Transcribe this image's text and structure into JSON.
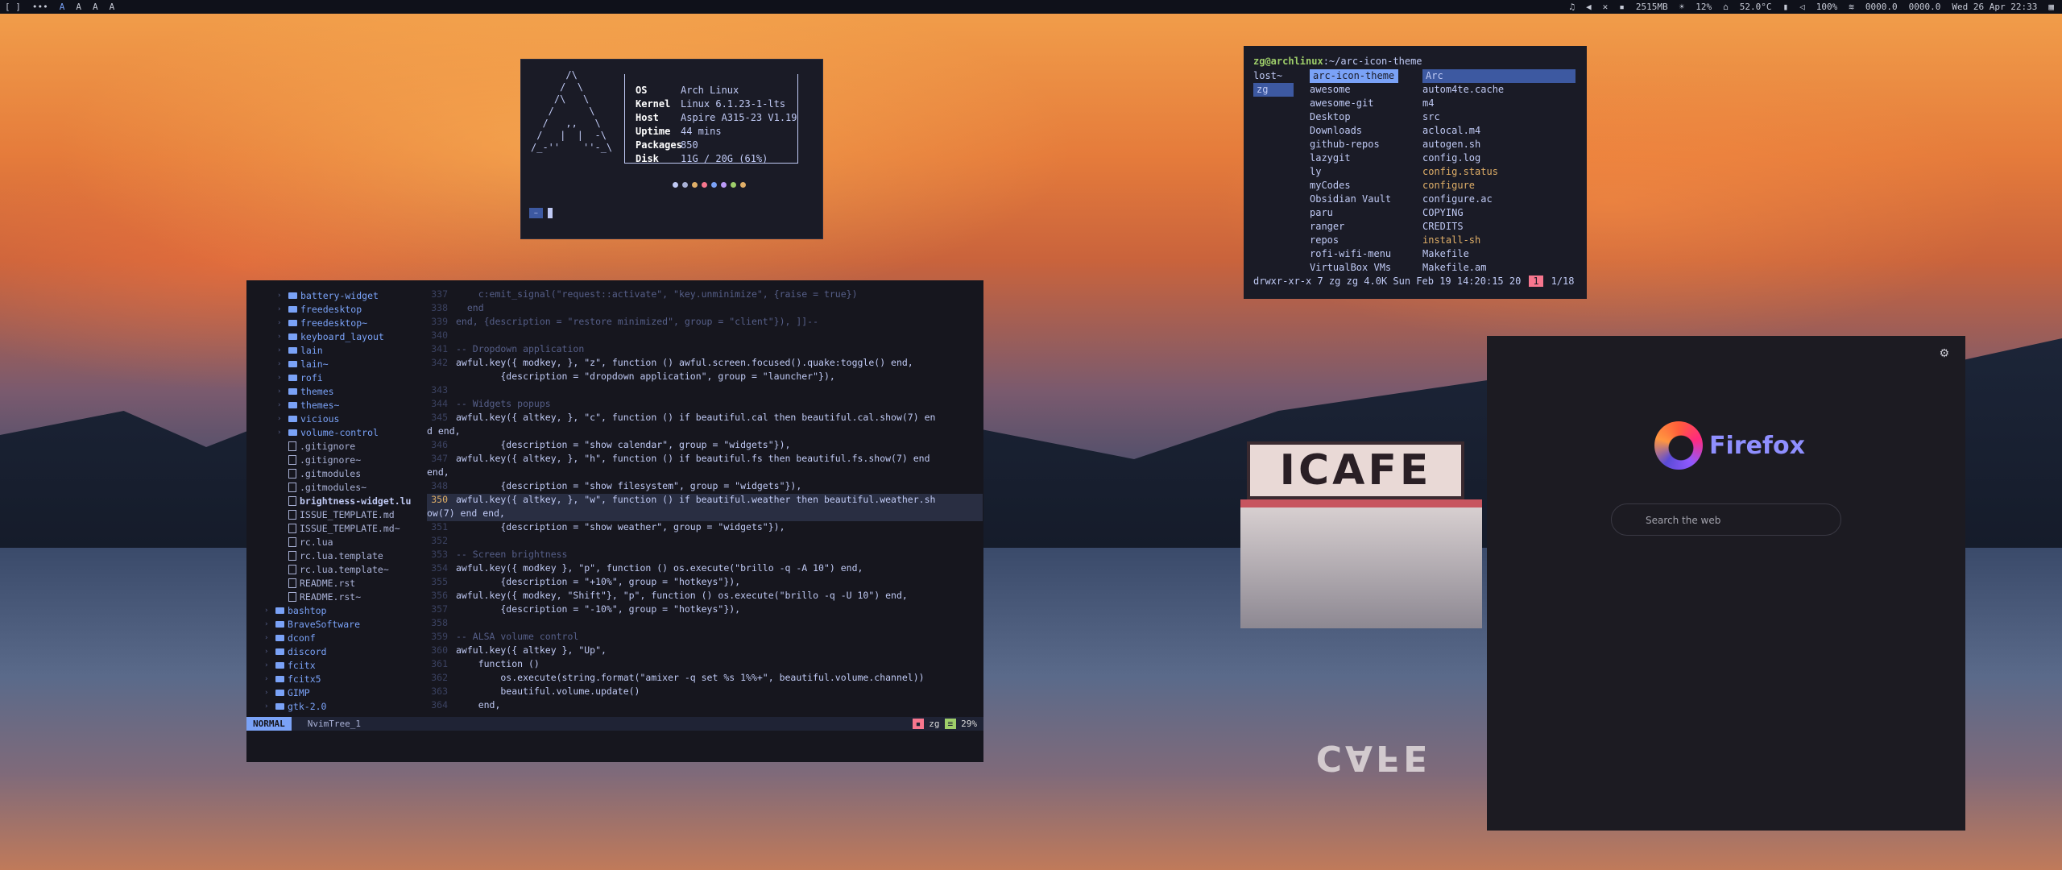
{
  "topbar": {
    "workspaces": [
      "[ ]",
      "•••",
      "A",
      "A",
      "A",
      "A"
    ],
    "status": {
      "memory": "2515MB",
      "brightness": "12%",
      "temp": "52.0°C",
      "battery": "100%",
      "net_down": "0000.0",
      "net_up": "0000.0",
      "clock": "Wed 26 Apr 22:33"
    }
  },
  "fetch": {
    "ascii": "      /\\\n     /  \\\n    /\\   \\\n   /      \\\n  /   ,,   \\\n /   |  |  -\\\n/_-''    ''-_\\",
    "rows": [
      {
        "key": "OS",
        "value": "Arch Linux"
      },
      {
        "key": "Kernel",
        "value": "Linux 6.1.23-1-lts"
      },
      {
        "key": "Host",
        "value": "Aspire A315-23 V1.19"
      },
      {
        "key": "Uptime",
        "value": "44 mins"
      },
      {
        "key": "Packages",
        "value": "850"
      },
      {
        "key": "Disk",
        "value": "11G / 20G (61%)"
      }
    ],
    "dot_colors": [
      "#c0caf5",
      "#a9b1d6",
      "#e0af68",
      "#f7768e",
      "#7aa2f7",
      "#bb9af7",
      "#9ece6a",
      "#e0af68"
    ],
    "prompt_badge": "~"
  },
  "ranger": {
    "title_user": "zg@archlinux",
    "title_path": ":~/arc-icon-theme",
    "col1": [
      "lost~",
      "zg"
    ],
    "col2": [
      "arc-icon-theme",
      "awesome",
      "awesome-git",
      "Desktop",
      "Downloads",
      "github-repos",
      "lazygit",
      "ly",
      "myCodes",
      "Obsidian Vault",
      "paru",
      "ranger",
      "repos",
      "rofi-wifi-menu",
      "VirtualBox VMs"
    ],
    "col3": [
      "Arc",
      "autom4te.cache",
      "m4",
      "src",
      "aclocal.m4",
      "autogen.sh",
      "config.log",
      "config.status",
      "configure",
      "configure.ac",
      "COPYING",
      "CREDITS",
      "install-sh",
      "Makefile",
      "Makefile.am"
    ],
    "status": "drwxr-xr-x 7 zg zg 4.0K Sun Feb 19 14:20:15 20",
    "tag": "1",
    "count": "1/18"
  },
  "editor": {
    "tree": [
      {
        "name": "battery-widget",
        "type": "dir"
      },
      {
        "name": "freedesktop",
        "type": "dir"
      },
      {
        "name": "freedesktop~",
        "type": "dir"
      },
      {
        "name": "keyboard_layout",
        "type": "dir"
      },
      {
        "name": "lain",
        "type": "dir"
      },
      {
        "name": "lain~",
        "type": "dir"
      },
      {
        "name": "rofi",
        "type": "dir"
      },
      {
        "name": "themes",
        "type": "dir"
      },
      {
        "name": "themes~",
        "type": "dir"
      },
      {
        "name": "vicious",
        "type": "dir"
      },
      {
        "name": "volume-control",
        "type": "dir"
      },
      {
        "name": ".gitignore",
        "type": "file"
      },
      {
        "name": ".gitignore~",
        "type": "file"
      },
      {
        "name": ".gitmodules",
        "type": "file"
      },
      {
        "name": ".gitmodules~",
        "type": "file"
      },
      {
        "name": "brightness-widget.lu",
        "type": "bold"
      },
      {
        "name": "ISSUE_TEMPLATE.md",
        "type": "file"
      },
      {
        "name": "ISSUE_TEMPLATE.md~",
        "type": "file"
      },
      {
        "name": "rc.lua",
        "type": "file"
      },
      {
        "name": "rc.lua.template",
        "type": "file"
      },
      {
        "name": "rc.lua.template~",
        "type": "file"
      },
      {
        "name": "README.rst",
        "type": "file"
      },
      {
        "name": "README.rst~",
        "type": "file"
      },
      {
        "name": "bashtop",
        "type": "topdir"
      },
      {
        "name": "BraveSoftware",
        "type": "topdir"
      },
      {
        "name": "dconf",
        "type": "topdir"
      },
      {
        "name": "discord",
        "type": "topdir"
      },
      {
        "name": "fcitx",
        "type": "topdir"
      },
      {
        "name": "fcitx5",
        "type": "topdir"
      },
      {
        "name": "GIMP",
        "type": "topdir"
      },
      {
        "name": "gtk-2.0",
        "type": "topdir"
      }
    ],
    "lines": [
      {
        "n": "337",
        "text": "    c:emit_signal(\"request::activate\", \"key.unminimize\", {raise = true})",
        "cls": "cmt"
      },
      {
        "n": "338",
        "text": "  end",
        "cls": "cmt"
      },
      {
        "n": "339",
        "text": "end, {description = \"restore minimized\", group = \"client\"}), ]]--",
        "cls": "cmt"
      },
      {
        "n": "340",
        "text": "",
        "cls": ""
      },
      {
        "n": "341",
        "text": "-- Dropdown application",
        "cls": "cmt"
      },
      {
        "n": "342",
        "text": "awful.key({ modkey, }, \"z\", function () awful.screen.focused().quake:toggle() end,",
        "cls": ""
      },
      {
        "n": "",
        "text": "        {description = \"dropdown application\", group = \"launcher\"}),",
        "cls": ""
      },
      {
        "n": "343",
        "text": "",
        "cls": ""
      },
      {
        "n": "344",
        "text": "-- Widgets popups",
        "cls": "cmt"
      },
      {
        "n": "345",
        "text": "awful.key({ altkey, }, \"c\", function () if beautiful.cal then beautiful.cal.show(7) en",
        "cls": ""
      },
      {
        "n": "",
        "text": "d end,",
        "cls": "wrap"
      },
      {
        "n": "346",
        "text": "        {description = \"show calendar\", group = \"widgets\"}),",
        "cls": ""
      },
      {
        "n": "347",
        "text": "awful.key({ altkey, }, \"h\", function () if beautiful.fs then beautiful.fs.show(7) end",
        "cls": ""
      },
      {
        "n": "",
        "text": "end,",
        "cls": "wrap"
      },
      {
        "n": "348",
        "text": "        {description = \"show filesystem\", group = \"widgets\"}),",
        "cls": ""
      },
      {
        "n": "350",
        "text": "awful.key({ altkey, }, \"w\", function () if beautiful.weather then beautiful.weather.sh",
        "cls": "cur"
      },
      {
        "n": "",
        "text": "ow(7) end end,",
        "cls": "wrap"
      },
      {
        "n": "351",
        "text": "        {description = \"show weather\", group = \"widgets\"}),",
        "cls": ""
      },
      {
        "n": "352",
        "text": "",
        "cls": ""
      },
      {
        "n": "353",
        "text": "-- Screen brightness",
        "cls": "cmt"
      },
      {
        "n": "354",
        "text": "awful.key({ modkey }, \"p\", function () os.execute(\"brillo -q -A 10\") end,",
        "cls": ""
      },
      {
        "n": "355",
        "text": "        {description = \"+10%\", group = \"hotkeys\"}),",
        "cls": ""
      },
      {
        "n": "356",
        "text": "awful.key({ modkey, \"Shift\"}, \"p\", function () os.execute(\"brillo -q -U 10\") end,",
        "cls": ""
      },
      {
        "n": "357",
        "text": "        {description = \"-10%\", group = \"hotkeys\"}),",
        "cls": ""
      },
      {
        "n": "358",
        "text": "",
        "cls": ""
      },
      {
        "n": "359",
        "text": "-- ALSA volume control",
        "cls": "cmt"
      },
      {
        "n": "360",
        "text": "awful.key({ altkey }, \"Up\",",
        "cls": ""
      },
      {
        "n": "361",
        "text": "    function ()",
        "cls": ""
      },
      {
        "n": "362",
        "text": "        os.execute(string.format(\"amixer -q set %s 1%%+\", beautiful.volume.channel))",
        "cls": ""
      },
      {
        "n": "363",
        "text": "        beautiful.volume.update()",
        "cls": ""
      },
      {
        "n": "364",
        "text": "    end,",
        "cls": ""
      }
    ],
    "status": {
      "mode": "NORMAL",
      "buffer": "NvimTree_1",
      "user": "zg",
      "percent": "29%"
    }
  },
  "firefox": {
    "brand": "Firefox",
    "search_placeholder": "Search the web"
  },
  "wallpaper": {
    "sign": "ICAFE",
    "reflection": "CAFE"
  }
}
